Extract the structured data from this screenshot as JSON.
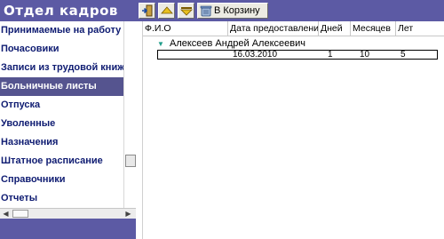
{
  "sidebar": {
    "title": "Отдел кадров",
    "items": [
      {
        "label": "Принимаемые на работу"
      },
      {
        "label": "Почасовики"
      },
      {
        "label": "Записи из трудовой книжки"
      },
      {
        "label": "Больничные листы"
      },
      {
        "label": "Отпуска"
      },
      {
        "label": "Уволенные"
      },
      {
        "label": "Назначения"
      },
      {
        "label": "Штатное расписание"
      },
      {
        "label": "Справочники"
      },
      {
        "label": "Отчеты"
      }
    ],
    "selected": "Больничные листы"
  },
  "toolbar": {
    "buttons": [
      {
        "icon": "exit-door-icon"
      },
      {
        "icon": "move-up-icon"
      },
      {
        "icon": "move-down-icon"
      },
      {
        "icon": "recycle-bin-icon",
        "label": "В Корзину"
      }
    ]
  },
  "grid": {
    "columns": [
      "Ф.И.О",
      "Дата предоставления",
      "Дней",
      "Месяцев",
      "Лет"
    ],
    "group": {
      "label": "Алексеев Андрей Алексеевич"
    },
    "rows": [
      {
        "date": "16.03.2010",
        "days": "1",
        "months": "10",
        "years": "5"
      }
    ]
  },
  "colors": {
    "panel": "#5c5aa4",
    "selected": "#55548f",
    "nav_text": "#0f1c72"
  }
}
